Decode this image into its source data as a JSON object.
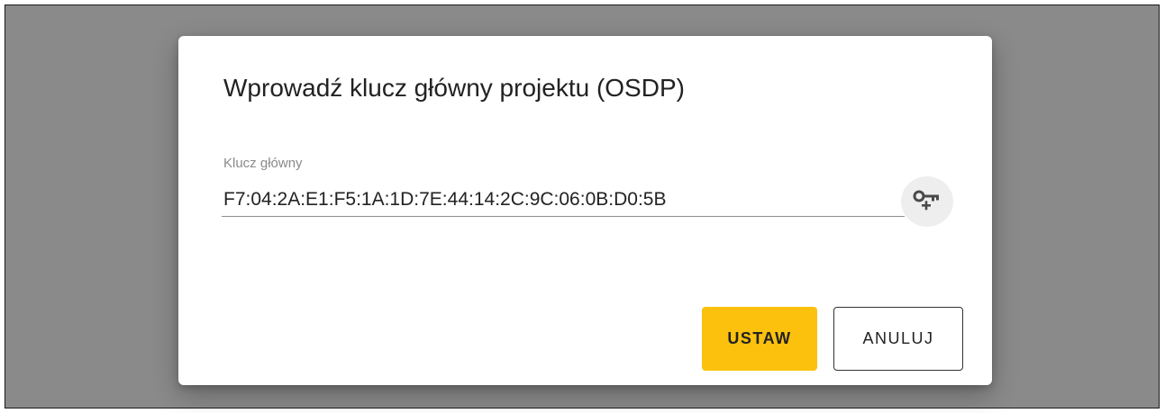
{
  "dialog": {
    "title": "Wprowadź klucz główny projektu (OSDP)",
    "field": {
      "label": "Klucz główny",
      "value": "F7:04:2A:E1:F5:1A:1D:7E:44:14:2C:9C:06:0B:D0:5B"
    },
    "generate_icon": "key-plus-icon",
    "buttons": {
      "confirm_label": "USTAW",
      "cancel_label": "ANULUJ"
    }
  },
  "colors": {
    "backdrop": "#8a8a8a",
    "accent": "#fbc10d",
    "text": "#222222"
  }
}
